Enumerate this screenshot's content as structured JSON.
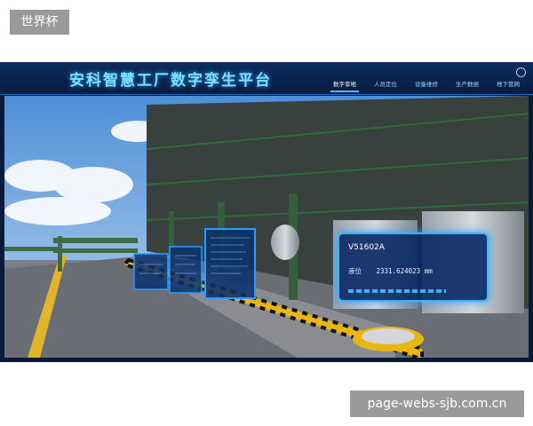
{
  "watermark_top": "世界杯",
  "watermark_bottom": "page-webs-sjb.com.cn",
  "header": {
    "title": "安科智慧工厂数字孪生平台",
    "nav": [
      "数字孪地",
      "人员定位",
      "设备维修",
      "生产数据",
      "地下管网"
    ],
    "active_index": 0
  },
  "equipment_card": {
    "id": "V51602A",
    "metric_label": "液位",
    "metric_value": "2331.624023 mm"
  },
  "colors": {
    "accent": "#38c6ff",
    "panel_border": "#2a9cff",
    "title": "#7fe0ff"
  }
}
